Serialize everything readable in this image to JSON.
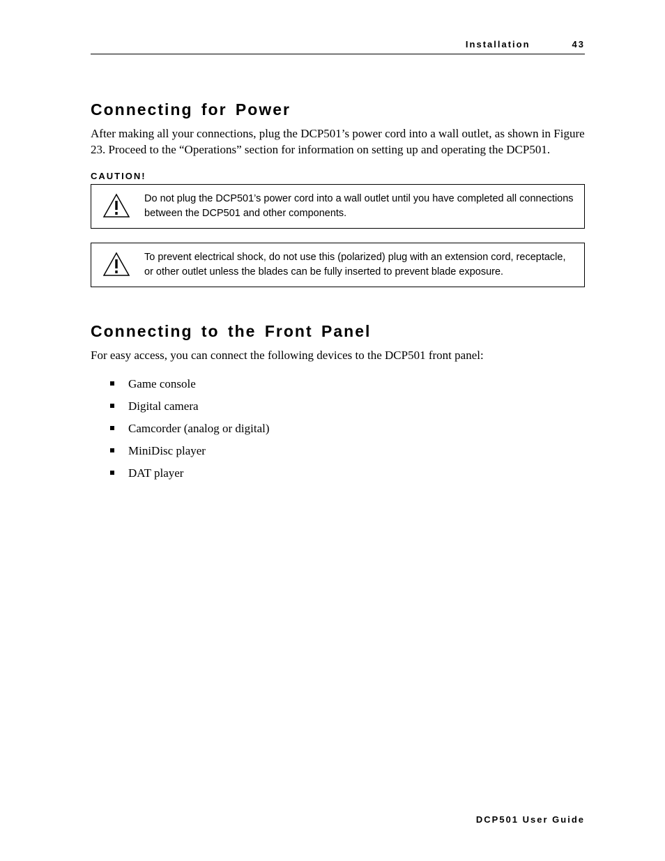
{
  "header": {
    "section": "Installation",
    "page_number": "43"
  },
  "sections": {
    "power": {
      "title": "Connecting for Power",
      "paragraph": "After making all your connections, plug the DCP501’s power cord into a wall outlet, as shown in Figure 23. Proceed to the “Operations” section for information on setting up and operating the DCP501.",
      "caution_label": "CAUTION!",
      "caution1": "Do not plug the DCP501’s power cord into a wall outlet until you have completed all connections between the DCP501 and other components.",
      "caution2": "To prevent electrical shock, do not use this (polarized) plug with an extension cord, receptacle, or other outlet unless the blades can be fully inserted to prevent blade exposure."
    },
    "front_panel": {
      "title": "Connecting to the Front Panel",
      "intro": "For easy access, you can connect the following devices to the DCP501 front panel:",
      "items": [
        "Game console",
        "Digital camera",
        "Camcorder (analog or digital)",
        "MiniDisc player",
        "DAT player"
      ]
    }
  },
  "footer": {
    "guide": "DCP501 User Guide"
  }
}
